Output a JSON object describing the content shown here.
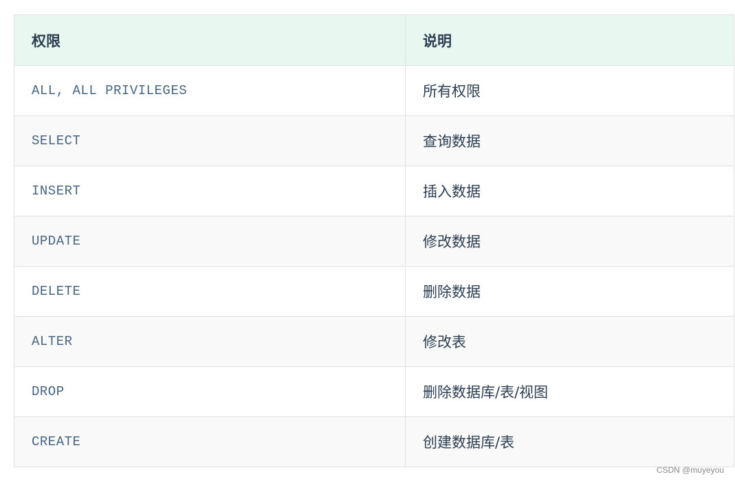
{
  "table": {
    "headers": [
      "权限",
      "说明"
    ],
    "rows": [
      {
        "privilege": "ALL, ALL PRIVILEGES",
        "description": "所有权限"
      },
      {
        "privilege": "SELECT",
        "description": "查询数据"
      },
      {
        "privilege": "INSERT",
        "description": "插入数据"
      },
      {
        "privilege": "UPDATE",
        "description": "修改数据"
      },
      {
        "privilege": "DELETE",
        "description": "删除数据"
      },
      {
        "privilege": "ALTER",
        "description": "修改表"
      },
      {
        "privilege": "DROP",
        "description": "删除数据库/表/视图"
      },
      {
        "privilege": "CREATE",
        "description": "创建数据库/表"
      }
    ]
  },
  "watermark": "CSDN @muyeyou",
  "colors": {
    "header_bg": "#e8f7ef",
    "border": "#dfe2e5",
    "stripe_bg": "#f9f9f9",
    "text": "#2c3e50",
    "code_text": "#476582"
  }
}
